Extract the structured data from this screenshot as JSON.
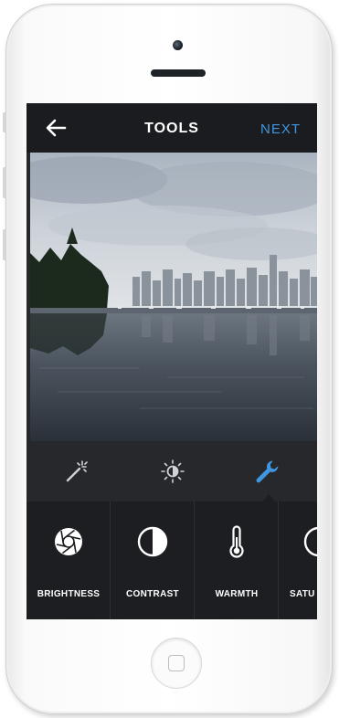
{
  "header": {
    "title": "TOOLS",
    "next_label": "NEXT",
    "back_icon": "back-arrow-icon"
  },
  "tabs": [
    {
      "icon": "magic-wand-icon",
      "active": false
    },
    {
      "icon": "brightness-sun-icon",
      "active": false
    },
    {
      "icon": "wrench-icon",
      "active": true
    }
  ],
  "tools": [
    {
      "label": "BRIGHTNESS",
      "icon": "aperture-icon"
    },
    {
      "label": "CONTRAST",
      "icon": "contrast-icon"
    },
    {
      "label": "WARMTH",
      "icon": "thermometer-icon"
    },
    {
      "label": "SATU",
      "icon": "saturation-icon"
    }
  ],
  "colors": {
    "accent": "#3e97e0",
    "topbar": "#1b1c1f",
    "tray": "#1d1e21"
  }
}
